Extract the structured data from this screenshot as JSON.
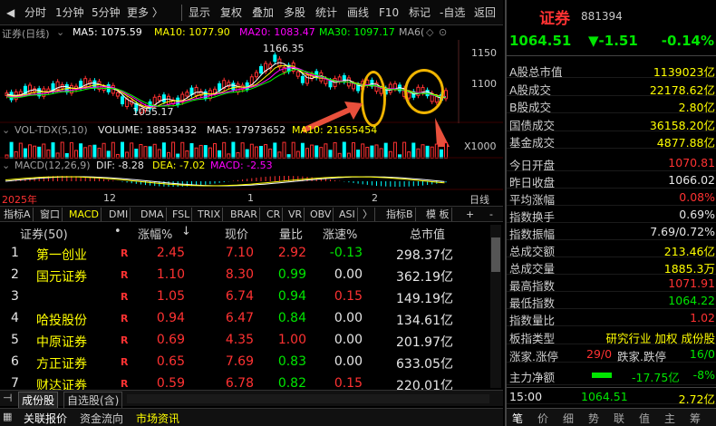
{
  "toolbar": {
    "buttons": [
      "分时",
      "1分钟",
      "5分钟",
      "更多 〉",
      "显示",
      "复权",
      "叠加",
      "多股",
      "统计",
      "画线",
      "F10",
      "标记",
      "-自选",
      "返回"
    ]
  },
  "chart": {
    "title": "证券(日线)",
    "ma5": "MA5: 1075.59",
    "ma10": "MA10: 1077.90",
    "ma20": "MA20: 1083.47",
    "ma30": "MA30: 1097.17",
    "ma60": "MA6(",
    "price_labels": [
      "1150",
      "1100"
    ],
    "high_label": "1166.35",
    "low_label": "1055.17",
    "vol_header": {
      "name": "VOL-TDX(5,10)",
      "volume": "VOLUME: 18853432",
      "ma5": "MA5: 17973652",
      "ma10": "MA10: 21655454"
    },
    "vol_scale": "X1000",
    "macd_header": {
      "name": "MACD(12,26,9)",
      "dif": "DIF: -8.28",
      "dea": "DEA: -7.02",
      "macd": "MACD: -2.53"
    },
    "axis": {
      "year": "2025年",
      "m12": "12",
      "m1": "1",
      "m2": "2",
      "period": "日线"
    },
    "colors": {
      "ma5": "#ffffff",
      "ma10": "#ffff00",
      "ma20": "#ff00ff",
      "ma30": "#00ff00",
      "up": "#ff3232",
      "down": "#00ffff",
      "annotation": "#f0b400",
      "arrow": "#e8503c"
    }
  },
  "indicator_tabs": [
    "指标A",
    "窗口",
    "MACD",
    "DMI",
    "DMA",
    "FSL",
    "TRIX",
    "BRAR",
    "CR",
    "VR",
    "OBV",
    "ASI",
    "〉",
    "指标B",
    "模 板",
    "+",
    "-"
  ],
  "table": {
    "headers": {
      "name": "证券(50)",
      "dot": "•",
      "change": "涨幅%",
      "sort_arrow": "↓",
      "price": "现价",
      "volume_ratio": "量比",
      "speed": "涨速%",
      "market_cap": "总市值"
    },
    "rows": [
      {
        "idx": "1",
        "name": "第一创业",
        "flag": "R",
        "change": "2.45",
        "price": "7.10",
        "vr": "2.92",
        "speed": "-0.13",
        "cap": "298.37亿"
      },
      {
        "idx": "2",
        "name": "国元证券",
        "flag": "R",
        "change": "1.10",
        "price": "8.30",
        "vr": "0.99",
        "speed": "0.00",
        "cap": "362.19亿"
      },
      {
        "idx": "3",
        "name": "",
        "flag": "R",
        "change": "1.05",
        "price": "6.74",
        "vr": "0.94",
        "speed": "0.15",
        "cap": "149.19亿"
      },
      {
        "idx": "4",
        "name": "哈投股份",
        "flag": "R",
        "change": "0.94",
        "price": "6.47",
        "vr": "0.84",
        "speed": "0.00",
        "cap": "134.61亿"
      },
      {
        "idx": "5",
        "name": "中原证券",
        "flag": "R",
        "change": "0.69",
        "price": "4.35",
        "vr": "1.00",
        "speed": "0.00",
        "cap": "201.97亿"
      },
      {
        "idx": "6",
        "name": "方正证券",
        "flag": "R",
        "change": "0.65",
        "price": "7.69",
        "vr": "0.83",
        "speed": "0.00",
        "cap": "633.05亿"
      },
      {
        "idx": "7",
        "name": "财达证券",
        "flag": "R",
        "change": "0.59",
        "price": "6.78",
        "vr": "0.82",
        "speed": "0.15",
        "cap": "220.01亿"
      }
    ]
  },
  "bottom_tabs": [
    "成份股",
    "自选股(含)"
  ],
  "status_tabs": [
    "关联报价",
    "资金流向",
    "市场资讯"
  ],
  "right_panel": {
    "name": "证券",
    "code": "881394",
    "price": "1064.51",
    "change": "▼-1.51",
    "change_pct": "-0.14%",
    "stats1": [
      {
        "label": "A股总市值",
        "value": "1139023亿"
      },
      {
        "label": "A股成交",
        "value": "22178.62亿"
      },
      {
        "label": "B股成交",
        "value": "2.80亿"
      },
      {
        "label": "国债成交",
        "value": "36158.20亿"
      },
      {
        "label": "基金成交",
        "value": "4877.88亿"
      }
    ],
    "stats2": [
      {
        "label": "今日开盘",
        "value": "1070.81",
        "color": "#ff3232"
      },
      {
        "label": "昨日收盘",
        "value": "1066.02",
        "color": "#e6e6e6"
      },
      {
        "label": "平均涨幅",
        "value": "0.08%",
        "color": "#ff3232"
      },
      {
        "label": "指数换手",
        "value": "0.69%",
        "color": "#e6e6e6"
      },
      {
        "label": "指数振幅",
        "value": "7.69/0.72%",
        "color": "#e6e6e6"
      },
      {
        "label": "总成交额",
        "value": "213.46亿",
        "color": "#ffff00"
      },
      {
        "label": "总成交量",
        "value": "1885.3万",
        "color": "#ffff00"
      },
      {
        "label": "最高指数",
        "value": "1071.91",
        "color": "#ff3232"
      },
      {
        "label": "最低指数",
        "value": "1064.22",
        "color": "#00e600"
      },
      {
        "label": "指数量比",
        "value": "1.02",
        "color": "#ff3232"
      }
    ],
    "board_type_label": "板指类型",
    "board_type_value": "研究行业 加权 成份股",
    "limit_up_label": "涨家.涨停",
    "limit_up_value": "29/0",
    "limit_down_label": "跌家.跌停",
    "limit_down_value": "16/0",
    "net_flow_label": "主力净额",
    "net_flow_value": "-17.75亿",
    "net_flow_pct": "-8%",
    "tick_time": "15:00",
    "tick_price": "1064.51",
    "tick_amount": "2.72亿",
    "bottom_tabs": [
      "笔",
      "价",
      "细",
      "势",
      "联",
      "值",
      "主",
      "筹"
    ]
  }
}
